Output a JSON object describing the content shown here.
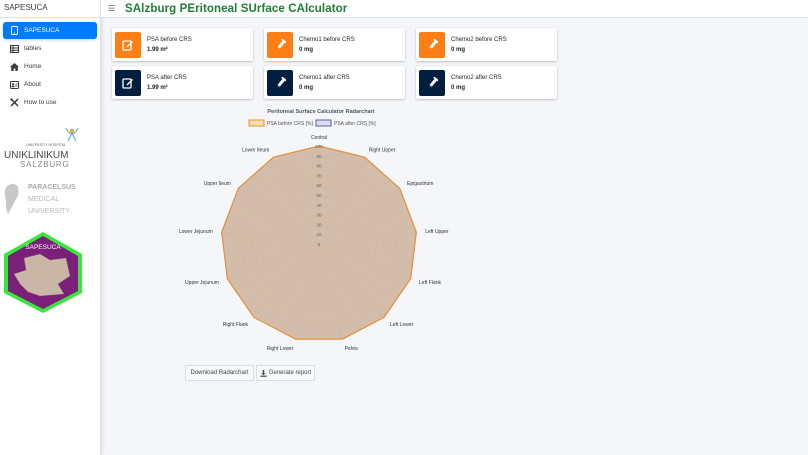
{
  "sidebar": {
    "brand": "SAPESUCA",
    "items": [
      {
        "label": "SAPESUCA"
      },
      {
        "label": "tables"
      },
      {
        "label": "Home"
      },
      {
        "label": "About"
      },
      {
        "label": "How to use"
      }
    ],
    "logos": {
      "uniklinikum_small": "UNIVERSITY HOSPITAL",
      "uniklinikum_1": "UNIKLINIKUM",
      "uniklinikum_2": "SALZBURG",
      "pmu_1": "PARACELSUS",
      "pmu_2": "MEDICAL",
      "pmu_3": "UNIVERSITY",
      "badge": "SAPESUCA"
    }
  },
  "header": {
    "title": "SAlzburg PEritoneal SUrface CAlculator"
  },
  "boxes": [
    {
      "label": "PSA before CRS",
      "value": "1.99 m²"
    },
    {
      "label": "Chemo1 before CRS",
      "value": "0 mg"
    },
    {
      "label": "Chemo2 before CRS",
      "value": "0 mg"
    },
    {
      "label": "PSA after CRS",
      "value": "1.99 m²"
    },
    {
      "label": "Chemo1 after CRS",
      "value": "0 mg"
    },
    {
      "label": "Chemo2 after CRS",
      "value": "0 mg"
    }
  ],
  "colors": {
    "orange": "#fd7e14",
    "navy": "#001f3f",
    "accent": "#007bff",
    "title_green": "#1e7e34"
  },
  "chart_data": {
    "type": "radar",
    "title": "Peritoneal Surface Calculator Radarchart",
    "categories": [
      "Central",
      "Right Upper",
      "Epigastrium",
      "Left Upper",
      "Left Flank",
      "Left Lower",
      "Pelvis",
      "Right Lower",
      "Right Flank",
      "Upper Jejunum",
      "Lower Jejunum",
      "Upper Ileum",
      "Lower Ileum"
    ],
    "series": [
      {
        "name": "PSA before CRS [%]",
        "values": [
          100,
          100,
          100,
          100,
          100,
          100,
          100,
          100,
          100,
          100,
          100,
          100,
          100
        ],
        "color": "#e69138"
      },
      {
        "name": "PSA after CRS [%]",
        "values": [
          100,
          100,
          100,
          100,
          100,
          100,
          100,
          100,
          100,
          100,
          100,
          100,
          100
        ],
        "color": "#5b5ea6"
      }
    ],
    "r_ticks": [
      "0",
      "10",
      "20",
      "30",
      "40",
      "50",
      "60",
      "70",
      "80",
      "90",
      "100"
    ],
    "rlim": [
      0,
      100
    ],
    "legend": "top"
  },
  "buttons": {
    "download": "Download Radarchart",
    "report": "Generate report"
  }
}
